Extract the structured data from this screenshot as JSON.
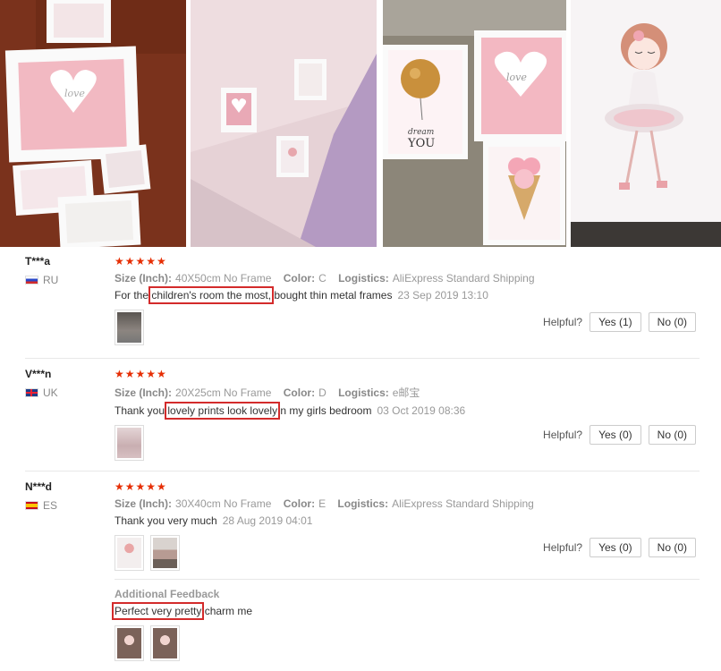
{
  "reviews": [
    {
      "user": "T***a",
      "country": "RU",
      "stars": "★★★★★",
      "size_label": "Size (Inch):",
      "size_value": "40X50cm No Frame",
      "color_label": "Color:",
      "color_value": "C",
      "logistics_label": "Logistics:",
      "logistics_value": "AliExpress Standard Shipping",
      "text_pre": "For the ",
      "text_hl": "children's room the most,",
      "text_post": " bought thin metal frames",
      "date": "23 Sep 2019 13:10",
      "helpful_label": "Helpful?",
      "yes_label": "Yes (1)",
      "no_label": "No (0)"
    },
    {
      "user": "V***n",
      "country": "UK",
      "stars": "★★★★★",
      "size_label": "Size (Inch):",
      "size_value": "20X25cm No Frame",
      "color_label": "Color:",
      "color_value": "D",
      "logistics_label": "Logistics:",
      "logistics_value": "e邮宝",
      "text_pre": "Thank you ",
      "text_hl": "lovely prints look lovely",
      "text_post": " n my girls bedroom",
      "date": "03 Oct 2019 08:36",
      "helpful_label": "Helpful?",
      "yes_label": "Yes (0)",
      "no_label": "No (0)"
    },
    {
      "user": "N***d",
      "country": "ES",
      "stars": "★★★★★",
      "size_label": "Size (Inch):",
      "size_value": "30X40cm No Frame",
      "color_label": "Color:",
      "color_value": "E",
      "logistics_label": "Logistics:",
      "logistics_value": "AliExpress Standard Shipping",
      "text": "Thank you very much",
      "date": "28 Aug 2019 04:01",
      "helpful_label": "Helpful?",
      "yes_label": "Yes (0)",
      "no_label": "No (0)",
      "additional_label": "Additional Feedback",
      "additional_hl": "Perfect very pretty",
      "additional_post": " charm me"
    }
  ],
  "photo_texts": {
    "love": "love",
    "love2": "love",
    "dream": "dream",
    "you": "YOU"
  },
  "colors": {
    "star": "#e62e04",
    "highlight_box": "#d32b2b"
  }
}
